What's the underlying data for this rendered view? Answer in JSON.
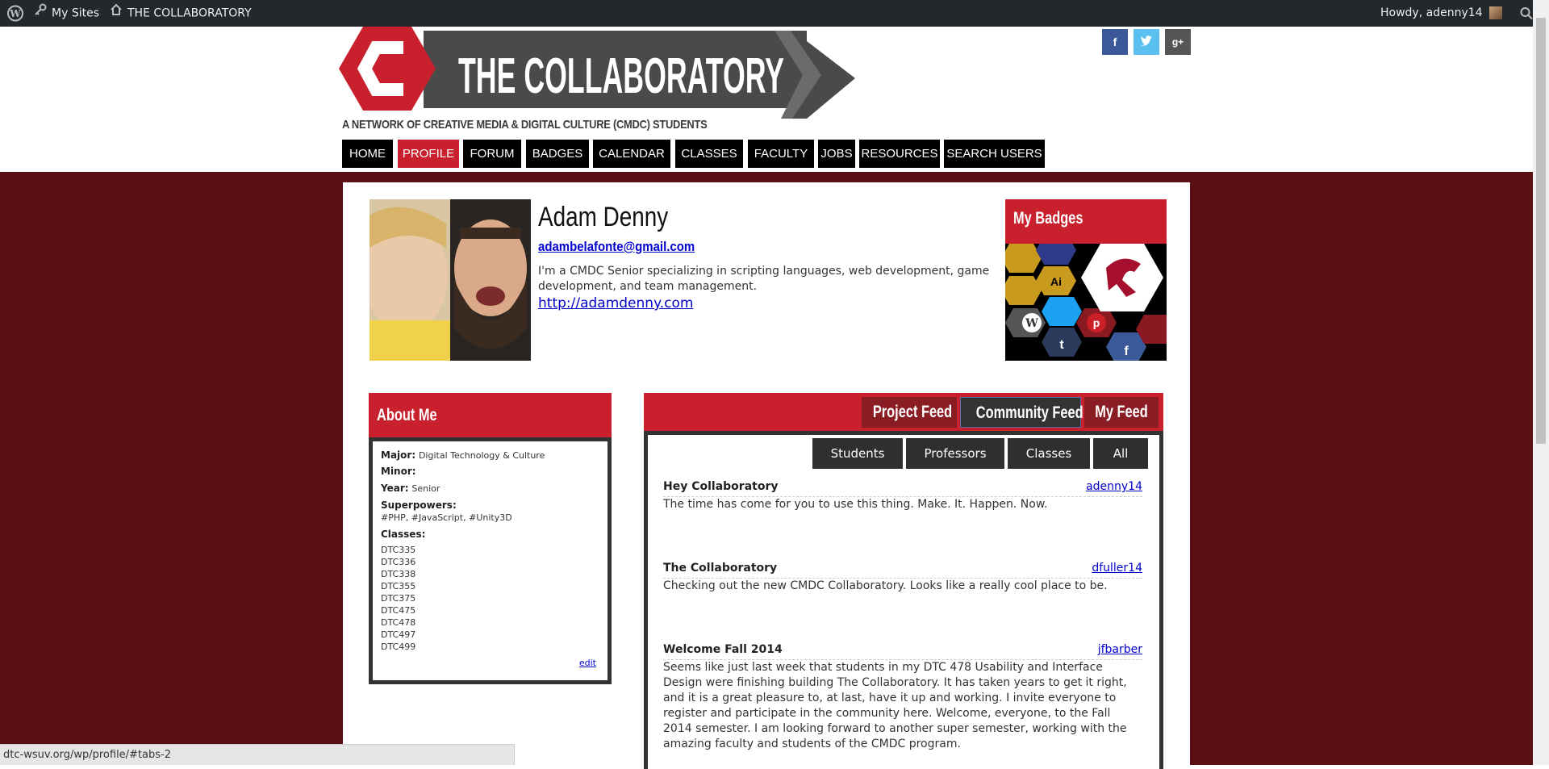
{
  "admin_bar": {
    "my_sites": "My Sites",
    "site_name": "THE COLLABORATORY",
    "howdy": "Howdy, adenny14"
  },
  "header": {
    "logo_text": "THE COLLABORATORY",
    "tagline": "A NETWORK OF CREATIVE MEDIA & DIGITAL CULTURE (CMDC) STUDENTS",
    "brand_color": "#c8202d",
    "social": [
      {
        "icon": "facebook-icon",
        "glyph": "f",
        "color": "#3b5998"
      },
      {
        "icon": "twitter-icon",
        "glyph": "t",
        "color": "#5bc0ef"
      },
      {
        "icon": "google-plus-icon",
        "glyph": "g+",
        "color": "#555555"
      }
    ]
  },
  "nav": {
    "items": [
      "HOME",
      "PROFILE",
      "FORUM",
      "BADGES",
      "CALENDAR",
      "CLASSES",
      "FACULTY",
      "JOBS",
      "RESOURCES",
      "SEARCH USERS"
    ],
    "active": "PROFILE"
  },
  "profile": {
    "name": "Adam Denny",
    "email": "adambelafonte@gmail.com",
    "bio": "I'm a CMDC Senior specializing in scripting languages, web development, game development, and team management.",
    "website": "http://adamdenny.com"
  },
  "badges": {
    "title": "My Badges"
  },
  "about": {
    "title": "About Me",
    "major_label": "Major:",
    "major": "Digital Technology & Culture",
    "minor_label": "Minor:",
    "minor": "",
    "year_label": "Year:",
    "year": "Senior",
    "superpowers_label": "Superpowers:",
    "superpowers": "#PHP, #JavaScript, #Unity3D",
    "classes_label": "Classes:",
    "classes": [
      "DTC335",
      "DTC336",
      "DTC338",
      "DTC355",
      "DTC375",
      "DTC475",
      "DTC478",
      "DTC497",
      "DTC499"
    ],
    "edit": "edit"
  },
  "feed": {
    "tabs": [
      "Project Feed",
      "Community Feed",
      "My Feed"
    ],
    "active_tab": "Community Feed",
    "subtabs": [
      "Students",
      "Professors",
      "Classes",
      "All"
    ],
    "posts": [
      {
        "title": "Hey Collaboratory",
        "author": "adenny14",
        "body": "The time has come for you to use this thing. Make. It. Happen. Now."
      },
      {
        "title": "The Collaboratory",
        "author": "dfuller14",
        "body": "Checking out the new CMDC Collaboratory.  Looks like a really cool place to be."
      },
      {
        "title": "Welcome Fall 2014",
        "author": "jfbarber",
        "body": "Seems like just last week that students in my DTC 478 Usability and Interface Design were finishing building The Collaboratory. It has taken years to get it right, and it is a great pleasure to, at last, have it up and working. I invite everyone to register and participate in the community here. Welcome, everyone, to the Fall 2014 semester. I am looking forward to another super semester, working with the amazing faculty and students of the CMDC program."
      }
    ]
  },
  "status_bar": "dtc-wsuv.org/wp/profile/#tabs-2"
}
